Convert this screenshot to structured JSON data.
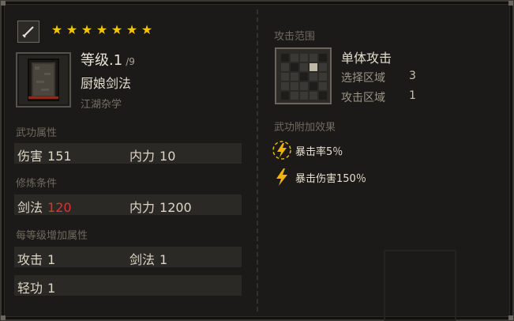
{
  "header": {
    "stars": [
      "★",
      "★",
      "★",
      "★",
      "★",
      "★",
      "★"
    ],
    "level_text": "等级.1",
    "level_max": "/9",
    "skill_name": "厨娘剑法",
    "category": "江湖杂学"
  },
  "attributes": {
    "label": "武功属性",
    "items": [
      {
        "name": "伤害",
        "value": "151"
      },
      {
        "name": "内力",
        "value": "10"
      }
    ]
  },
  "requirements": {
    "label": "修炼条件",
    "items": [
      {
        "name": "剑法",
        "value": "120",
        "color": "#e0322d"
      },
      {
        "name": "内力",
        "value": "1200"
      }
    ]
  },
  "per_level": {
    "label": "每等级增加属性",
    "rows": [
      [
        {
          "name": "攻击",
          "value": "1"
        },
        {
          "name": "剑法",
          "value": "1"
        }
      ],
      [
        {
          "name": "轻功",
          "value": "1"
        }
      ]
    ]
  },
  "attack_range": {
    "label": "攻击范围",
    "type": "单体攻击",
    "select_label": "选择区域",
    "select_value": "3",
    "attack_label": "攻击区域",
    "attack_value": "1",
    "icon": "range-grid-icon"
  },
  "effects": {
    "label": "武功附加效果",
    "items": [
      {
        "icon": "lightning-icon",
        "text": "暴击率5％"
      },
      {
        "icon": "lightning-icon",
        "text": "暴击伤害150％"
      }
    ]
  },
  "colors": {
    "star": "#f1c40f",
    "lightning": "#f0b400",
    "requirement_unmet": "#e0322d"
  }
}
